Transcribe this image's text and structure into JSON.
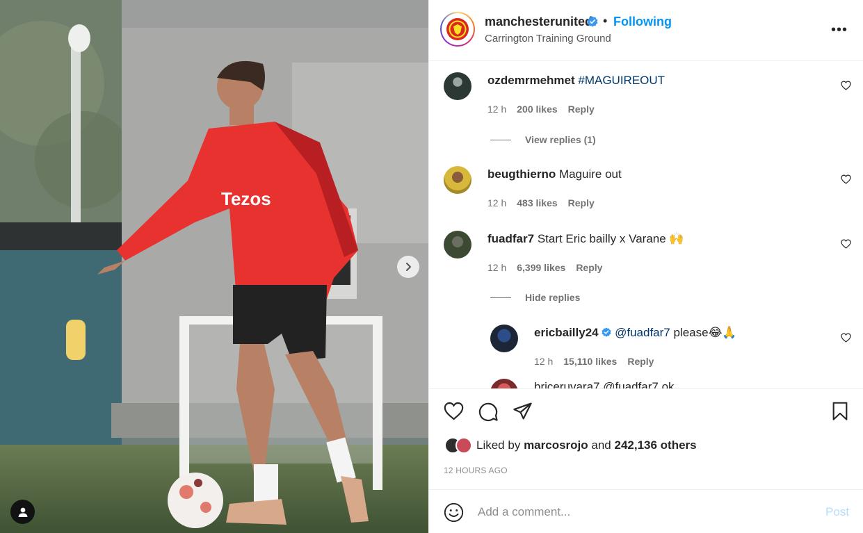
{
  "post": {
    "username": "manchesterunited",
    "separator": "•",
    "follow_label": "Following",
    "location": "Carrington Training Ground",
    "more_label": "•••"
  },
  "comments": [
    {
      "username": "ozdemrmehmet",
      "text": "",
      "mention": "#MAGUIREOUT",
      "time": "12 h",
      "likes": "200 likes",
      "reply_label": "Reply",
      "replies_toggle": "View replies (1)"
    },
    {
      "username": "beugthierno",
      "text": "Maguire out",
      "time": "12 h",
      "likes": "483 likes",
      "reply_label": "Reply"
    },
    {
      "username": "fuadfar7",
      "text": "Start Eric bailly x Varane 🙌",
      "time": "12 h",
      "likes": "6,399 likes",
      "reply_label": "Reply",
      "replies_toggle": "Hide replies"
    }
  ],
  "reply": {
    "username": "ericbailly24",
    "mention": "@fuadfar7",
    "text": "please😂🙏",
    "time": "12 h",
    "likes": "15,110 likes",
    "reply_label": "Reply"
  },
  "partial_reply": {
    "text": "briceruvara7 @fuadfar7 ok"
  },
  "likes_summary": {
    "prefix": "Liked by",
    "user": "marcosrojo",
    "middle": "and",
    "count": "242,136 others"
  },
  "timestamp": "12 HOURS AGO",
  "comment_box": {
    "placeholder": "Add a comment...",
    "post_label": "Post"
  },
  "colors": {
    "accent": "#0095f6",
    "kit_red": "#e8322f",
    "post_disabled": "#b2dffc"
  },
  "icons": [
    "chevron-right-icon",
    "tagged-user-icon",
    "verified-badge-icon",
    "more-icon",
    "heart-icon",
    "comment-icon",
    "share-icon",
    "bookmark-icon",
    "emoji-icon"
  ]
}
